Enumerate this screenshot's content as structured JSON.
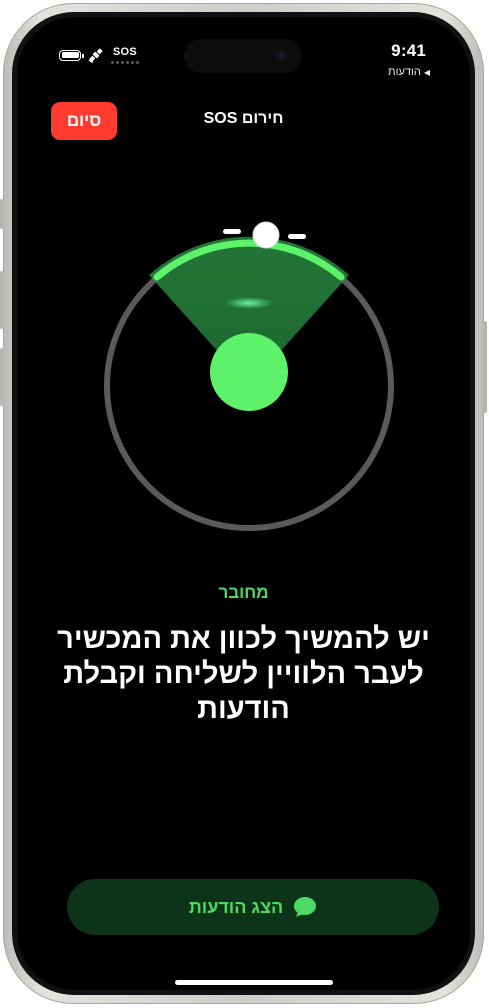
{
  "status_bar": {
    "sos": "SOS",
    "time": "9:41",
    "back_label": "הודעות",
    "icons": [
      "battery-icon",
      "satellite-icon",
      "signal-dots-icon",
      "back-triangle-icon"
    ]
  },
  "header": {
    "title": "חירום SOS",
    "done_label": "סיום",
    "done_color": "#ff3b30"
  },
  "satellite_view": {
    "connected_color": "#4cd964"
  },
  "connection": {
    "status": "מחובר"
  },
  "instruction": {
    "text": "יש להמשיך לכוון את המכשיר לעבר הלוויין לשליחה וקבלת הודעות"
  },
  "bottom": {
    "show_messages_label": "הצג הודעות",
    "icon": "message-bubble-icon"
  }
}
